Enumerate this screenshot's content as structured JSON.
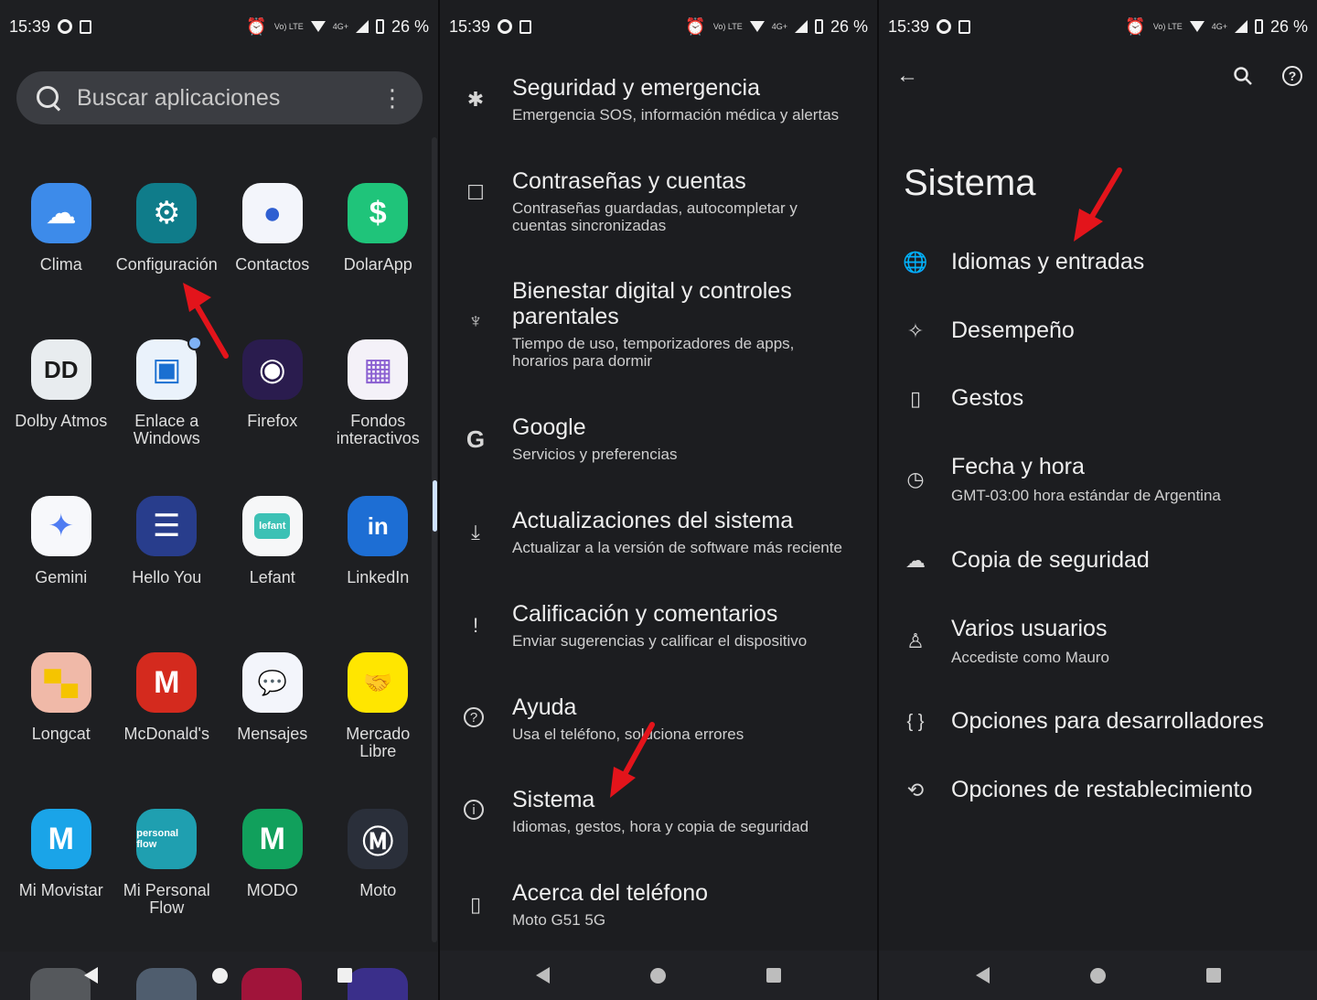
{
  "status": {
    "time": "15:39",
    "network": "4G+",
    "volte": "Vo) LTE",
    "battery": "26 %"
  },
  "drawer": {
    "search_placeholder": "Buscar aplicaciones",
    "apps": [
      {
        "label": "Clima",
        "icon": "cloud-sun-icon",
        "color": "#3d8bea",
        "glyph": "☁"
      },
      {
        "label": "Configuración",
        "icon": "gear-icon",
        "color": "#0f7c8a",
        "glyph": "⚙"
      },
      {
        "label": "Contactos",
        "icon": "person-icon",
        "color": "#f3f5fb",
        "glyph": "●"
      },
      {
        "label": "DolarApp",
        "icon": "dollar-note-icon",
        "color": "#1fc47a",
        "glyph": "$"
      },
      {
        "label": "Dolby Atmos",
        "icon": "dolby-icon",
        "color": "#e8ecef",
        "glyph": "DD"
      },
      {
        "label": "Enlace a\nWindows",
        "icon": "link-to-windows-icon",
        "color": "#eaf2fb",
        "glyph": "▣"
      },
      {
        "label": "Firefox",
        "icon": "firefox-icon",
        "color": "#2a1c4e",
        "glyph": "◉"
      },
      {
        "label": "Fondos\ninteractivos",
        "icon": "wallpaper-icon",
        "color": "#f4f1f8",
        "glyph": "▦"
      },
      {
        "label": "Gemini",
        "icon": "gemini-star-icon",
        "color": "#f7f8fb",
        "glyph": "✦"
      },
      {
        "label": "Hello You",
        "icon": "hello-you-icon",
        "color": "#283d8c",
        "glyph": "☰"
      },
      {
        "label": "Lefant",
        "icon": "lefant-icon",
        "color": "#f6f7f8",
        "glyph": "lefant"
      },
      {
        "label": "LinkedIn",
        "icon": "linkedin-icon",
        "color": "#1d6ed4",
        "glyph": "in"
      },
      {
        "label": "Longcat",
        "icon": "longcat-icon",
        "color": "#f0b9a8",
        "glyph": "▀▄"
      },
      {
        "label": "McDonald's",
        "icon": "mcdonalds-icon",
        "color": "#d42a1e",
        "glyph": "M"
      },
      {
        "label": "Mensajes",
        "icon": "messages-icon",
        "color": "#f3f5fb",
        "glyph": "💬"
      },
      {
        "label": "Mercado\nLibre",
        "icon": "mercado-libre-icon",
        "color": "#ffe600",
        "glyph": "🤝"
      },
      {
        "label": "Mi Movistar",
        "icon": "movistar-icon",
        "color": "#1aa4e8",
        "glyph": "M"
      },
      {
        "label": "Mi Personal\nFlow",
        "icon": "personal-flow-icon",
        "color": "#1f9fb0",
        "glyph": "personal flow"
      },
      {
        "label": "MODO",
        "icon": "modo-icon",
        "color": "#11a05c",
        "glyph": "M"
      },
      {
        "label": "Moto",
        "icon": "moto-icon",
        "color": "#2a2f3a",
        "glyph": "Ⓜ"
      }
    ]
  },
  "settings": {
    "items": [
      {
        "title": "Seguridad y emergencia",
        "subtitle": "Emergencia SOS, información médica y alertas",
        "icon": "asterisk-icon",
        "glyph": "✱"
      },
      {
        "title": "Contraseñas y cuentas",
        "subtitle": "Contraseñas guardadas, autocompletar y\ncuentas sincronizadas",
        "icon": "account-box-icon",
        "glyph": "☐"
      },
      {
        "title": "Bienestar digital y controles\nparentales",
        "subtitle": "Tiempo de uso, temporizadores de apps,\nhorarios para dormir",
        "icon": "wellbeing-icon",
        "glyph": "♆"
      },
      {
        "title": "Google",
        "subtitle": "Servicios y preferencias",
        "icon": "google-g-icon",
        "glyph": "G"
      },
      {
        "title": "Actualizaciones del sistema",
        "subtitle": "Actualizar a la versión de software más reciente",
        "icon": "system-update-icon",
        "glyph": "⤓"
      },
      {
        "title": "Calificación y comentarios",
        "subtitle": "Enviar sugerencias y calificar el dispositivo",
        "icon": "feedback-icon",
        "glyph": "!"
      },
      {
        "title": "Ayuda",
        "subtitle": "Usa el teléfono, soluciona errores",
        "icon": "help-icon",
        "glyph": "?"
      },
      {
        "title": "Sistema",
        "subtitle": "Idiomas, gestos, hora y copia de seguridad",
        "icon": "info-icon",
        "glyph": "i"
      },
      {
        "title": "Acerca del teléfono",
        "subtitle": "Moto G51 5G",
        "icon": "phone-info-icon",
        "glyph": "▯"
      }
    ]
  },
  "sistema": {
    "title": "Sistema",
    "items": [
      {
        "title": "Idiomas y entradas",
        "subtitle": "",
        "icon": "globe-icon",
        "glyph": "🌐"
      },
      {
        "title": "Desempeño",
        "subtitle": "",
        "icon": "performance-icon",
        "glyph": "✧"
      },
      {
        "title": "Gestos",
        "subtitle": "",
        "icon": "gestures-phone-icon",
        "glyph": "▯"
      },
      {
        "title": "Fecha y hora",
        "subtitle": "GMT-03:00 hora estándar de Argentina",
        "icon": "clock-icon",
        "glyph": "◷"
      },
      {
        "title": "Copia de seguridad",
        "subtitle": "",
        "icon": "cloud-upload-icon",
        "glyph": "☁"
      },
      {
        "title": "Varios usuarios",
        "subtitle": "Accediste como Mauro",
        "icon": "user-icon",
        "glyph": "♙"
      },
      {
        "title": "Opciones para desarrolladores",
        "subtitle": "",
        "icon": "braces-icon",
        "glyph": "{ }"
      },
      {
        "title": "Opciones de restablecimiento",
        "subtitle": "",
        "icon": "history-icon",
        "glyph": "⟲"
      }
    ]
  },
  "colors": {
    "annotation_arrow": "#e3141b",
    "background": "#1c1d20"
  }
}
